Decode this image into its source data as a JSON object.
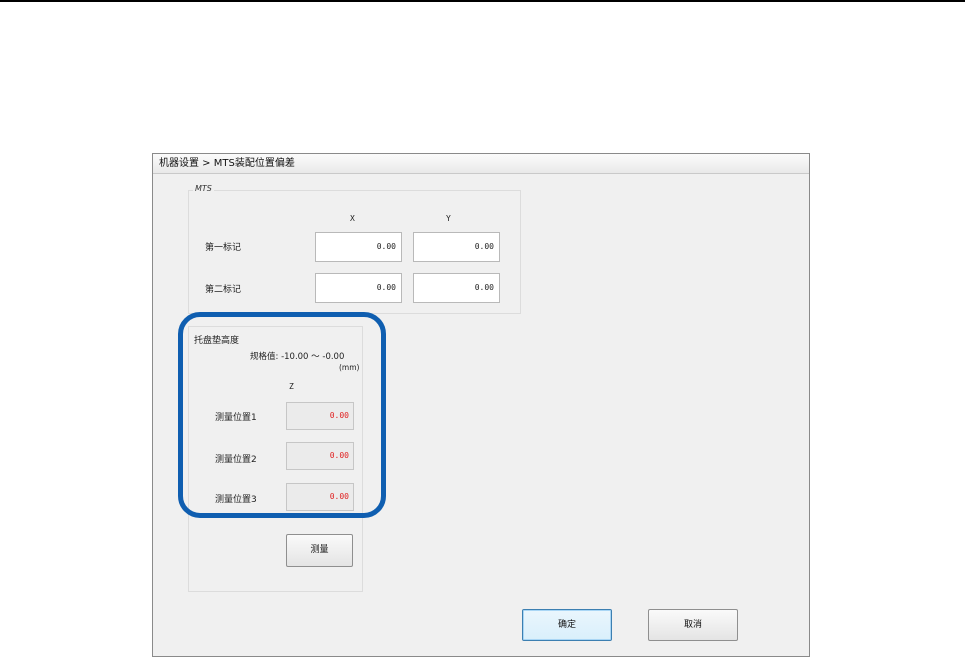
{
  "dialog": {
    "title": "机器设置 > MTS装配位置偏差"
  },
  "mts": {
    "legend": "MTS",
    "col_x": "X",
    "col_y": "Y",
    "rows": [
      {
        "label": "第一标记",
        "x": "0.00",
        "y": "0.00"
      },
      {
        "label": "第二标记",
        "x": "0.00",
        "y": "0.00"
      }
    ]
  },
  "tray": {
    "title": "托盘垫高度",
    "spec_label": "规格值: -10.00 ～ -0.00",
    "unit": "(mm)",
    "col_z": "Z",
    "rows": [
      {
        "label": "测量位置1",
        "z": "0.00"
      },
      {
        "label": "测量位置2",
        "z": "0.00"
      },
      {
        "label": "测量位置3",
        "z": "0.00"
      }
    ],
    "measure_button": "测量"
  },
  "buttons": {
    "ok": "确定",
    "cancel": "取消"
  },
  "colors": {
    "highlight": "#0f5eb0",
    "readonly_value": "#e02020"
  }
}
